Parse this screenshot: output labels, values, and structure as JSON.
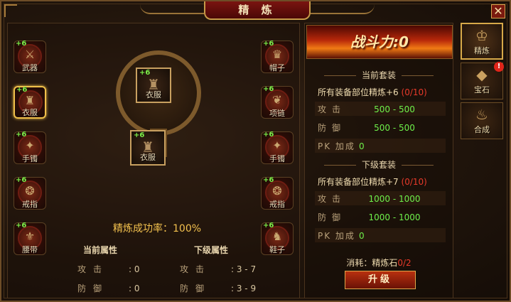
{
  "window": {
    "title": "精 炼",
    "close_label": "✕"
  },
  "slots_left": [
    {
      "name": "武器",
      "plus": "+6",
      "icon": "sword-icon",
      "glyph": "⚔"
    },
    {
      "name": "衣服",
      "plus": "+6",
      "icon": "armor-icon",
      "glyph": "♜"
    },
    {
      "name": "手镯",
      "plus": "+6",
      "icon": "bracelet-icon",
      "glyph": "✦"
    },
    {
      "name": "戒指",
      "plus": "+6",
      "icon": "ring-icon",
      "glyph": "❂"
    },
    {
      "name": "腰带",
      "plus": "+6",
      "icon": "belt-icon",
      "glyph": "⚜"
    }
  ],
  "slots_right": [
    {
      "name": "帽子",
      "plus": "+6",
      "icon": "helmet-icon",
      "glyph": "♛"
    },
    {
      "name": "项链",
      "plus": "+6",
      "icon": "necklace-icon",
      "glyph": "❦"
    },
    {
      "name": "手镯",
      "plus": "+6",
      "icon": "bracelet-icon",
      "glyph": "✦"
    },
    {
      "name": "戒指",
      "plus": "+6",
      "icon": "ring-icon",
      "glyph": "❂"
    },
    {
      "name": "鞋子",
      "plus": "+6",
      "icon": "boots-icon",
      "glyph": "♞"
    }
  ],
  "center": {
    "current_item": {
      "name": "衣服",
      "plus": "+6",
      "glyph": "♜"
    },
    "next_item": {
      "name": "衣服",
      "plus": "+6",
      "glyph": "♜"
    },
    "success_rate": "精炼成功率：100%"
  },
  "current_attrs": {
    "title": "当前属性",
    "rows": [
      {
        "label": "攻击",
        "value": ": 0"
      },
      {
        "label": "防御",
        "value": ": 0"
      }
    ]
  },
  "next_attrs": {
    "title": "下级属性",
    "rows": [
      {
        "label": "攻击",
        "value": ": 3 - 7"
      },
      {
        "label": "防御",
        "value": ": 3 - 9"
      }
    ]
  },
  "right": {
    "power_label": "战斗力:0",
    "current_set": {
      "title": "当前套装",
      "desc": "所有装备部位精炼+6 ",
      "progress": "(0/10)",
      "stats": [
        {
          "label": "攻击",
          "value": "500 - 500"
        },
        {
          "label": "防御",
          "value": "500 - 500"
        },
        {
          "label": "PK 加成",
          "value": "0"
        }
      ]
    },
    "next_set": {
      "title": "下级套装",
      "desc": "所有装备部位精炼+7 ",
      "progress": "(0/10)",
      "stats": [
        {
          "label": "攻击",
          "value": "1000 - 1000"
        },
        {
          "label": "防御",
          "value": "1000 - 1000"
        },
        {
          "label": "PK 加成",
          "value": "0"
        }
      ]
    },
    "cost_label": "消耗：",
    "cost_item": "精炼石",
    "cost_have": "0/2",
    "upgrade_label": "升级"
  },
  "tabs": [
    {
      "label": "精炼",
      "icon": "refine-icon",
      "glyph": "♔",
      "active": true
    },
    {
      "label": "宝石",
      "icon": "gem-icon",
      "glyph": "◆",
      "alert": "!"
    },
    {
      "label": "合成",
      "icon": "cauldron-icon",
      "glyph": "♨"
    }
  ],
  "colors": {
    "accent_gold": "#f2c14e",
    "green_value": "#6ef04a",
    "red_progress": "#e83a2a",
    "panel_bg": "#21150c"
  }
}
